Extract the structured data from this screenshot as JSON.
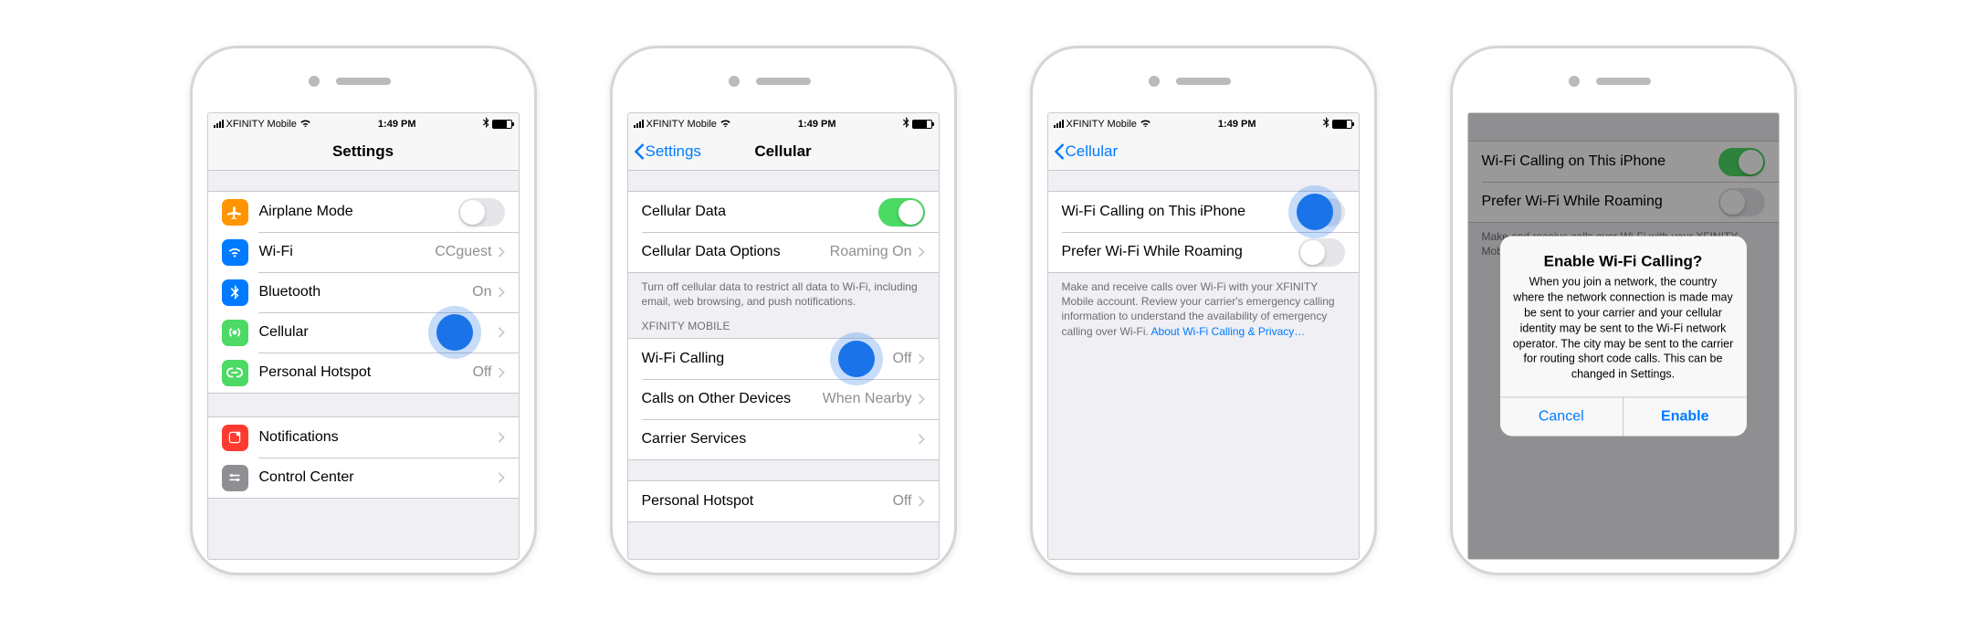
{
  "status": {
    "carrier": "XFINITY Mobile",
    "time": "1:49 PM"
  },
  "phone1": {
    "title": "Settings",
    "rows": {
      "airplane": {
        "label": "Airplane Mode",
        "icon_bg": "#ff9500"
      },
      "wifi": {
        "label": "Wi-Fi",
        "value": "CCguest",
        "icon_bg": "#007aff"
      },
      "bluetooth": {
        "label": "Bluetooth",
        "value": "On",
        "icon_bg": "#007aff"
      },
      "cellular": {
        "label": "Cellular",
        "icon_bg": "#4cd964"
      },
      "hotspot": {
        "label": "Personal Hotspot",
        "value": "Off",
        "icon_bg": "#4cd964"
      },
      "notifications": {
        "label": "Notifications",
        "icon_bg": "#ff3b30"
      },
      "control_center": {
        "label": "Control Center",
        "icon_bg": "#8e8e93"
      }
    }
  },
  "phone2": {
    "back": "Settings",
    "title": "Cellular",
    "rows": {
      "cellular_data": {
        "label": "Cellular Data"
      },
      "cellular_data_options": {
        "label": "Cellular Data Options",
        "value": "Roaming On"
      },
      "footer1": "Turn off cellular data to restrict all data to Wi-Fi, including email, web browsing, and push notifications.",
      "section_header": "XFINITY MOBILE",
      "wifi_calling": {
        "label": "Wi-Fi Calling",
        "value": "Off"
      },
      "other_devices": {
        "label": "Calls on Other Devices",
        "value": "When Nearby"
      },
      "carrier_services": {
        "label": "Carrier Services"
      },
      "hotspot": {
        "label": "Personal Hotspot",
        "value": "Off"
      }
    }
  },
  "phone3": {
    "back": "Cellular",
    "rows": {
      "wifi_calling_iphone": {
        "label": "Wi-Fi Calling on This iPhone"
      },
      "prefer_roaming": {
        "label": "Prefer Wi-Fi While Roaming"
      }
    },
    "footer": "Make and receive calls over Wi-Fi with your XFINITY Mobile account. Review your carrier's emergency calling information to understand the availability of emergency calling over Wi-Fi. ",
    "footer_link": "About Wi-Fi Calling & Privacy…"
  },
  "phone4": {
    "rows": {
      "wifi_calling_iphone": {
        "label": "Wi-Fi Calling on This iPhone"
      },
      "prefer_roaming": {
        "label": "Prefer Wi-Fi While Roaming"
      }
    },
    "footer_partial": "Make and receive calls over Wi-Fi with your XFINITY Mobile",
    "alert": {
      "title": "Enable Wi-Fi Calling?",
      "message": "When you join a network, the country where the network connection is made may be sent to your carrier and your cellular identity may be sent to the Wi-Fi network operator. The city may be sent to the carrier for routing short code calls. This can be changed in Settings.",
      "cancel": "Cancel",
      "enable": "Enable"
    }
  }
}
